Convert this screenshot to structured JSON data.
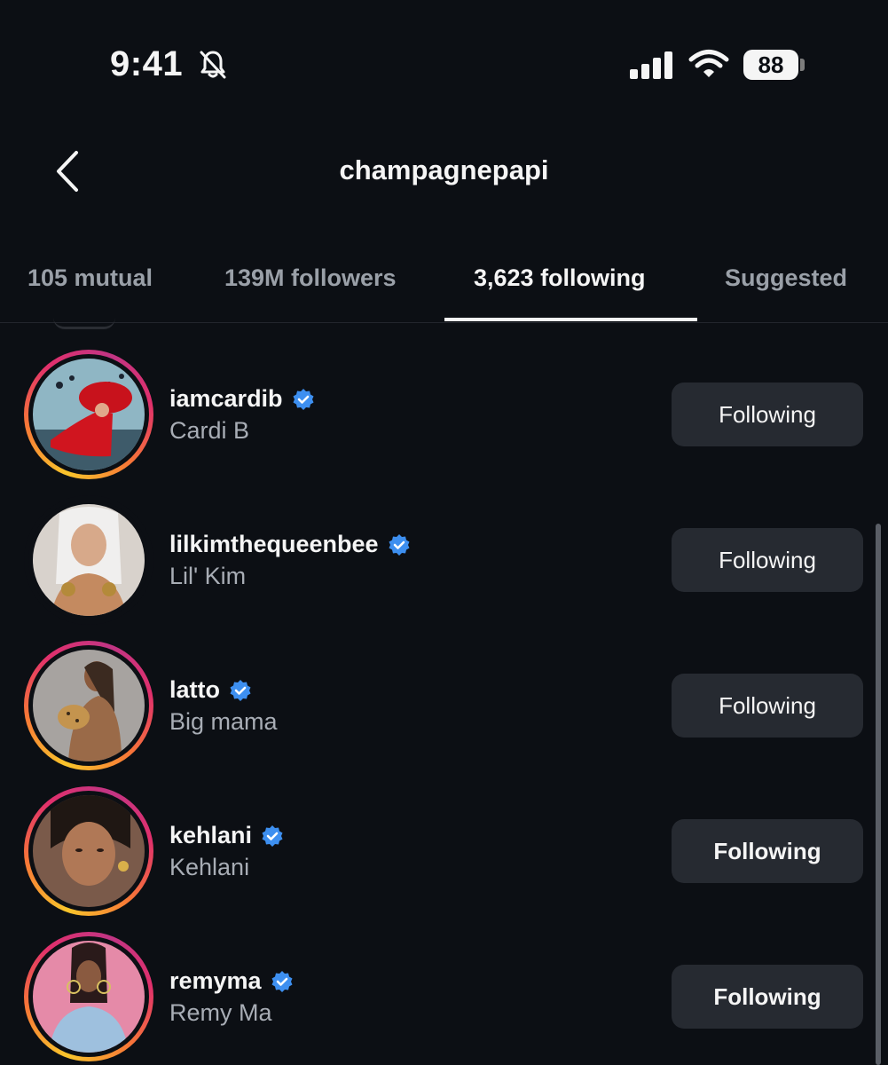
{
  "status_bar": {
    "time": "9:41",
    "battery": "88",
    "icons": [
      "bell-slash-icon",
      "cellular-signal-icon",
      "wifi-icon",
      "battery-icon"
    ]
  },
  "header": {
    "title": "champagnepapi",
    "back_icon": "chevron-left-icon"
  },
  "tabs": [
    {
      "label": "105 mutual",
      "active": false
    },
    {
      "label": "139M followers",
      "active": false
    },
    {
      "label": "3,623 following",
      "active": true
    },
    {
      "label": "Suggested",
      "active": false
    }
  ],
  "colors": {
    "background": "#0c0f14",
    "button": "#262a31",
    "verified": "#3d8ff0",
    "secondary_text": "#a8adb5",
    "story_ring": [
      "#f9c52b",
      "#f77737",
      "#e1306c",
      "#c13584"
    ]
  },
  "following": [
    {
      "username": "iamcardib",
      "name": "Cardi B",
      "verified": true,
      "button": "Following",
      "story_ring": true
    },
    {
      "username": "lilkimthequeenbee",
      "name": "Lil' Kim",
      "verified": true,
      "button": "Following",
      "story_ring": false
    },
    {
      "username": "latto",
      "name": "Big mama",
      "verified": true,
      "button": "Following",
      "story_ring": true
    },
    {
      "username": "kehlani",
      "name": "Kehlani",
      "verified": true,
      "button": "Following",
      "story_ring": true
    },
    {
      "username": "remyma",
      "name": "Remy Ma",
      "verified": true,
      "button": "Following",
      "story_ring": true
    }
  ]
}
